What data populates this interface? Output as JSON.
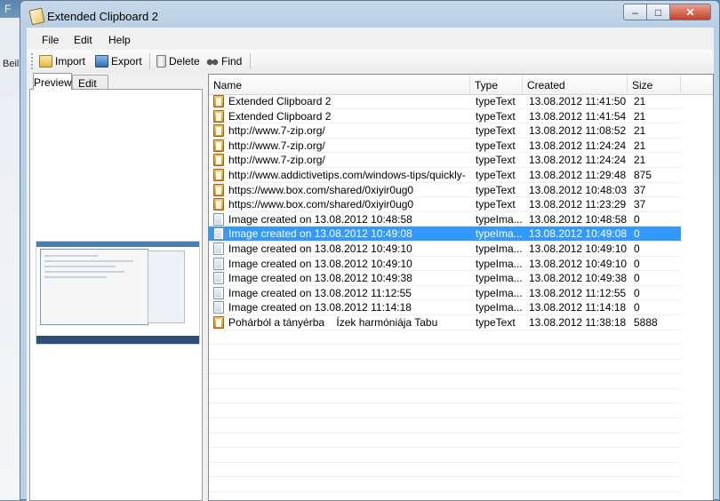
{
  "background_app": {
    "menu_letter": "F",
    "side_label": "Beil"
  },
  "window": {
    "title": "Extended Clipboard 2",
    "controls": {
      "minimize": "–",
      "maximize": "□",
      "close": "✕"
    }
  },
  "menu": [
    "File",
    "Edit",
    "Help"
  ],
  "toolbar": {
    "import_label": "Import",
    "export_label": "Export",
    "delete_label": "Delete",
    "find_label": "Find"
  },
  "tabs": {
    "preview": "Preview",
    "edit": "Edit"
  },
  "list": {
    "columns": [
      "Name",
      "Type",
      "Created",
      "Size"
    ],
    "selected_index": 9,
    "rows": [
      {
        "icon": "text-clip-icon",
        "name": "Extended Clipboard 2",
        "type": "typeText",
        "created": "13.08.2012 11:41:50",
        "size": "21"
      },
      {
        "icon": "text-clip-icon",
        "name": "Extended Clipboard 2",
        "type": "typeText",
        "created": "13.08.2012 11:41:54",
        "size": "21"
      },
      {
        "icon": "text-clip-icon",
        "name": "http://www.7-zip.org/",
        "type": "typeText",
        "created": "13.08.2012 11:08:52",
        "size": "21"
      },
      {
        "icon": "text-clip-icon",
        "name": "http://www.7-zip.org/",
        "type": "typeText",
        "created": "13.08.2012 11:24:24",
        "size": "21"
      },
      {
        "icon": "text-clip-icon",
        "name": "http://www.7-zip.org/",
        "type": "typeText",
        "created": "13.08.2012 11:24:24",
        "size": "21"
      },
      {
        "icon": "text-clip-icon",
        "name": "http://www.addictivetips.com/windows-tips/quickly-",
        "type": "typeText",
        "created": "13.08.2012 11:29:48",
        "size": "875"
      },
      {
        "icon": "text-clip-icon",
        "name": "https://www.box.com/shared/0xiyir0ug0",
        "type": "typeText",
        "created": "13.08.2012 10:48:03",
        "size": "37"
      },
      {
        "icon": "text-clip-icon",
        "name": "https://www.box.com/shared/0xiyir0ug0",
        "type": "typeText",
        "created": "13.08.2012 11:23:29",
        "size": "37"
      },
      {
        "icon": "image-clip-icon",
        "name": "Image created on 13.08.2012 10:48:58",
        "type": "typeIma...",
        "created": "13.08.2012 10:48:58",
        "size": "0"
      },
      {
        "icon": "image-clip-icon",
        "name": "Image created on 13.08.2012 10:49:08",
        "type": "typeIma...",
        "created": "13.08.2012 10:49:08",
        "size": "0"
      },
      {
        "icon": "image-clip-icon",
        "name": "Image created on 13.08.2012 10:49:10",
        "type": "typeIma...",
        "created": "13.08.2012 10:49:10",
        "size": "0"
      },
      {
        "icon": "image-clip-icon",
        "name": "Image created on 13.08.2012 10:49:10",
        "type": "typeIma...",
        "created": "13.08.2012 10:49:10",
        "size": "0"
      },
      {
        "icon": "image-clip-icon",
        "name": "Image created on 13.08.2012 10:49:38",
        "type": "typeIma...",
        "created": "13.08.2012 10:49:38",
        "size": "0"
      },
      {
        "icon": "image-clip-icon",
        "name": "Image created on 13.08.2012 11:12:55",
        "type": "typeIma...",
        "created": "13.08.2012 11:12:55",
        "size": "0"
      },
      {
        "icon": "image-clip-icon",
        "name": "Image created on 13.08.2012 11:14:18",
        "type": "typeIma...",
        "created": "13.08.2012 11:14:18",
        "size": "0"
      },
      {
        "icon": "text-clip-icon",
        "name": "Pohárból a tányérba    Ízek harmóniája Tabu",
        "type": "typeText",
        "created": "13.08.2012 11:38:18",
        "size": "5888"
      }
    ]
  },
  "colors": {
    "selection": "#3399ff",
    "window_frame": "#b9cfe5",
    "close_button": "#c7402a"
  }
}
